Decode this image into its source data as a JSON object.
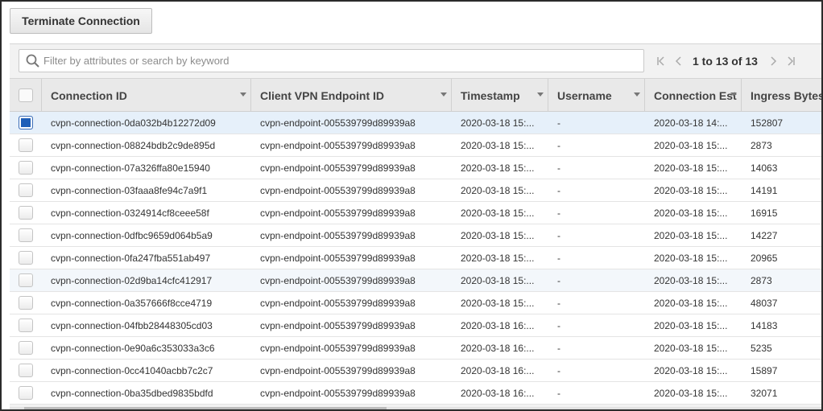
{
  "toolbar": {
    "terminate_label": "Terminate Connection"
  },
  "search": {
    "placeholder": "Filter by attributes or search by keyword",
    "value": ""
  },
  "pager": {
    "text": "1 to 13 of 13"
  },
  "columns": [
    {
      "label": ""
    },
    {
      "label": "Connection ID"
    },
    {
      "label": "Client VPN Endpoint ID"
    },
    {
      "label": "Timestamp"
    },
    {
      "label": "Username"
    },
    {
      "label": "Connection Est"
    },
    {
      "label": "Ingress Bytes"
    }
  ],
  "rows": [
    {
      "selected": true,
      "conn": "cvpn-connection-0da032b4b12272d09",
      "endpoint": "cvpn-endpoint-005539799d89939a8",
      "timestamp": "2020-03-18 15:...",
      "username": "-",
      "established": "2020-03-18 14:...",
      "ingress": "152807"
    },
    {
      "selected": false,
      "conn": "cvpn-connection-08824bdb2c9de895d",
      "endpoint": "cvpn-endpoint-005539799d89939a8",
      "timestamp": "2020-03-18 15:...",
      "username": "-",
      "established": "2020-03-18 15:...",
      "ingress": "2873"
    },
    {
      "selected": false,
      "conn": "cvpn-connection-07a326ffa80e15940",
      "endpoint": "cvpn-endpoint-005539799d89939a8",
      "timestamp": "2020-03-18 15:...",
      "username": "-",
      "established": "2020-03-18 15:...",
      "ingress": "14063"
    },
    {
      "selected": false,
      "conn": "cvpn-connection-03faaa8fe94c7a9f1",
      "endpoint": "cvpn-endpoint-005539799d89939a8",
      "timestamp": "2020-03-18 15:...",
      "username": "-",
      "established": "2020-03-18 15:...",
      "ingress": "14191"
    },
    {
      "selected": false,
      "conn": "cvpn-connection-0324914cf8ceee58f",
      "endpoint": "cvpn-endpoint-005539799d89939a8",
      "timestamp": "2020-03-18 15:...",
      "username": "-",
      "established": "2020-03-18 15:...",
      "ingress": "16915"
    },
    {
      "selected": false,
      "conn": "cvpn-connection-0dfbc9659d064b5a9",
      "endpoint": "cvpn-endpoint-005539799d89939a8",
      "timestamp": "2020-03-18 15:...",
      "username": "-",
      "established": "2020-03-18 15:...",
      "ingress": "14227"
    },
    {
      "selected": false,
      "conn": "cvpn-connection-0fa247fba551ab497",
      "endpoint": "cvpn-endpoint-005539799d89939a8",
      "timestamp": "2020-03-18 15:...",
      "username": "-",
      "established": "2020-03-18 15:...",
      "ingress": "20965"
    },
    {
      "selected": false,
      "conn": "cvpn-connection-02d9ba14cfc412917",
      "endpoint": "cvpn-endpoint-005539799d89939a8",
      "timestamp": "2020-03-18 15:...",
      "username": "-",
      "established": "2020-03-18 15:...",
      "ingress": "2873"
    },
    {
      "selected": false,
      "conn": "cvpn-connection-0a357666f8cce4719",
      "endpoint": "cvpn-endpoint-005539799d89939a8",
      "timestamp": "2020-03-18 15:...",
      "username": "-",
      "established": "2020-03-18 15:...",
      "ingress": "48037"
    },
    {
      "selected": false,
      "conn": "cvpn-connection-04fbb28448305cd03",
      "endpoint": "cvpn-endpoint-005539799d89939a8",
      "timestamp": "2020-03-18 16:...",
      "username": "-",
      "established": "2020-03-18 15:...",
      "ingress": "14183"
    },
    {
      "selected": false,
      "conn": "cvpn-connection-0e90a6c353033a3c6",
      "endpoint": "cvpn-endpoint-005539799d89939a8",
      "timestamp": "2020-03-18 16:...",
      "username": "-",
      "established": "2020-03-18 15:...",
      "ingress": "5235"
    },
    {
      "selected": false,
      "conn": "cvpn-connection-0cc41040acbb7c2c7",
      "endpoint": "cvpn-endpoint-005539799d89939a8",
      "timestamp": "2020-03-18 16:...",
      "username": "-",
      "established": "2020-03-18 15:...",
      "ingress": "15897"
    },
    {
      "selected": false,
      "conn": "cvpn-connection-0ba35dbed9835bdfd",
      "endpoint": "cvpn-endpoint-005539799d89939a8",
      "timestamp": "2020-03-18 16:...",
      "username": "-",
      "established": "2020-03-18 15:...",
      "ingress": "32071"
    }
  ]
}
